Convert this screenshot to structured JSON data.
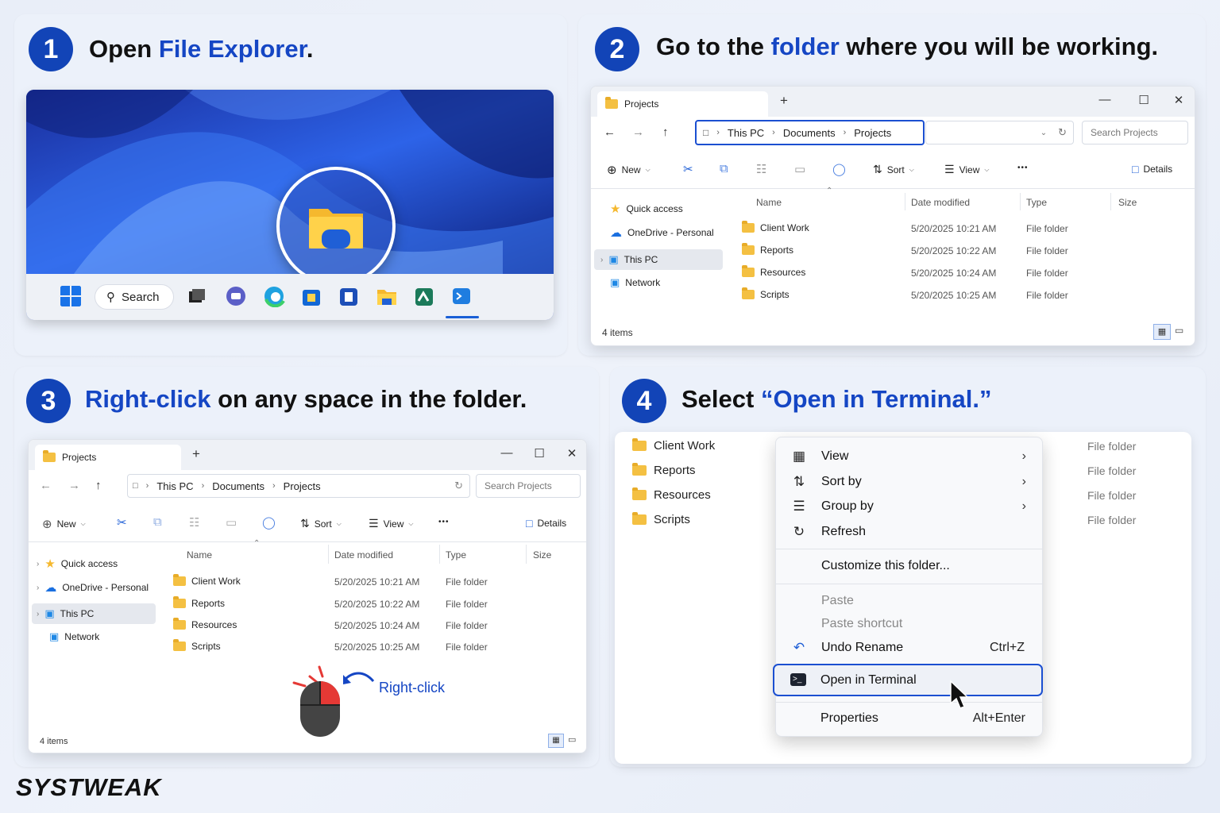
{
  "steps": [
    {
      "num": "1",
      "pre": "Open ",
      "hl": "File Explorer",
      "post": "."
    },
    {
      "num": "2",
      "pre": "Go to the ",
      "hl": "folder",
      "post": " where you will be working."
    },
    {
      "num": "3",
      "pre": "",
      "hl": "Right-click",
      "post": " on any space in the folder."
    },
    {
      "num": "4",
      "pre": "Select ",
      "hl": "“Open in Terminal.”",
      "post": ""
    }
  ],
  "taskbar": {
    "search_label": "Search"
  },
  "explorer": {
    "tab_title": "Projects",
    "breadcrumb": [
      "This PC",
      "Documents",
      "Projects"
    ],
    "search_placeholder": "Search Projects",
    "toolbar": {
      "new": "New",
      "sort": "Sort",
      "view": "View",
      "more": "•••",
      "details": "Details"
    },
    "nav": [
      "Quick access",
      "OneDrive - Personal",
      "This PC",
      "Network"
    ],
    "columns": [
      "Name",
      "Date modified",
      "Type",
      "Size"
    ],
    "rows": [
      {
        "name": "Client Work",
        "date": "5/20/2025 10:21 AM",
        "type": "File folder"
      },
      {
        "name": "Reports",
        "date": "5/20/2025 10:22 AM",
        "type": "File folder"
      },
      {
        "name": "Resources",
        "date": "5/20/2025 10:24 AM",
        "type": "File folder"
      },
      {
        "name": "Scripts",
        "date": "5/20/2025 10:25 AM",
        "type": "File folder"
      }
    ],
    "status": "4 items"
  },
  "rightclick_label": "Right-click",
  "step4": {
    "folders": [
      "Client Work",
      "Reports",
      "Resources",
      "Scripts"
    ],
    "folder_type": "File folder",
    "menu": {
      "view": "View",
      "sort_by": "Sort by",
      "group_by": "Group by",
      "refresh": "Refresh",
      "customize": "Customize this folder...",
      "paste": "Paste",
      "paste_shortcut": "Paste shortcut",
      "undo_rename": "Undo Rename",
      "undo_shortcut": "Ctrl+Z",
      "open_terminal": "Open in Terminal",
      "properties": "Properties",
      "properties_shortcut": "Alt+Enter"
    }
  },
  "brand": "SYSTWEAK",
  "colors": {
    "accent": "#1546c4",
    "step_badge": "#1244b7",
    "folder": "#f4c042"
  }
}
